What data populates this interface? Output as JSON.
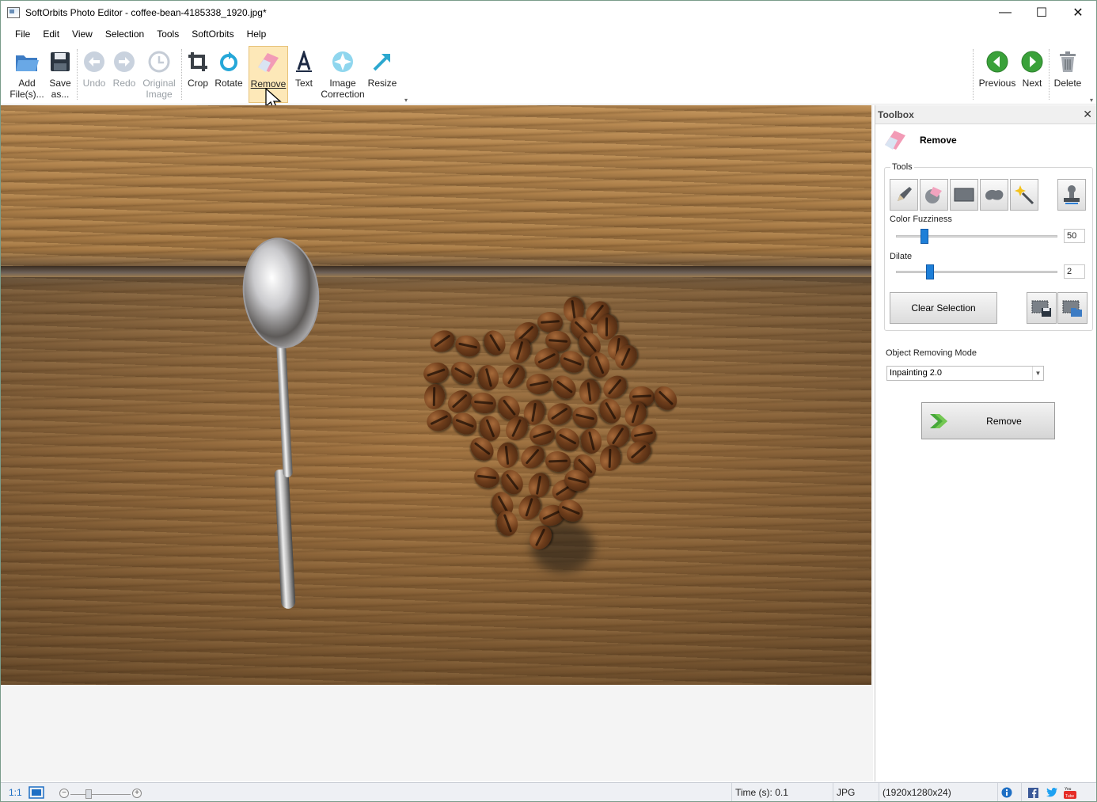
{
  "window": {
    "title": "SoftOrbits Photo Editor - coffee-bean-4185338_1920.jpg*",
    "minimize": "—",
    "maximize": "☐",
    "close": "✕"
  },
  "menu": [
    {
      "label": "File"
    },
    {
      "label": "Edit"
    },
    {
      "label": "View"
    },
    {
      "label": "Selection"
    },
    {
      "label": "Tools"
    },
    {
      "label": "SoftOrbits"
    },
    {
      "label": "Help"
    }
  ],
  "ribbon": {
    "add_files": "Add\nFile(s)...",
    "save_as": "Save\nas...",
    "undo": "Undo",
    "redo": "Redo",
    "original_image": "Original\nImage",
    "crop": "Crop",
    "rotate": "Rotate",
    "remove": "Remove",
    "text": "Text",
    "image_correction": "Image\nCorrection",
    "resize": "Resize",
    "previous": "Previous",
    "next": "Next",
    "delete": "Delete"
  },
  "toolbox": {
    "header": "Toolbox",
    "close": "✕",
    "title": "Remove",
    "tools_label": "Tools",
    "color_fuzziness_label": "Color Fuzziness",
    "color_fuzziness_value": "50",
    "dilate_label": "Dilate",
    "dilate_value": "2",
    "clear_selection": "Clear Selection",
    "mode_label": "Object Removing Mode",
    "mode_value": "Inpainting 2.0",
    "remove_button": "Remove"
  },
  "statusbar": {
    "zoom_1_1": "1:1",
    "time": "Time (s): 0.1",
    "format": "JPG",
    "dimensions": "(1920x1280x24)"
  },
  "colors": {
    "accent": "#1e7fd8",
    "active_tool_bg": "#fde8b8",
    "nav_green": "#3aa13a"
  }
}
